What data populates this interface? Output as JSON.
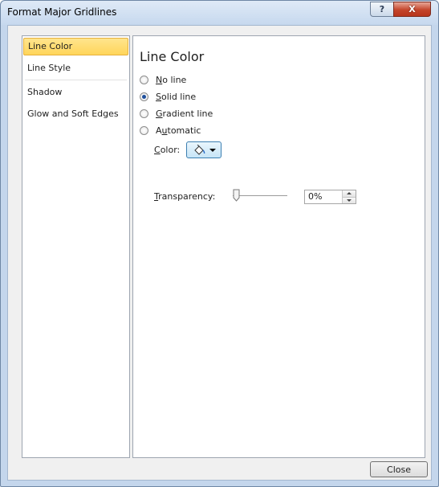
{
  "window": {
    "title": "Format Major Gridlines",
    "help_glyph": "?",
    "close_glyph": "X"
  },
  "nav": {
    "items": [
      {
        "label": "Line Color"
      },
      {
        "label": "Line Style"
      },
      {
        "label": "Shadow"
      },
      {
        "label": "Glow and Soft Edges"
      }
    ],
    "selected": "Line Color"
  },
  "panel": {
    "title": "Line Color",
    "options": [
      {
        "label": "No line",
        "checked": false
      },
      {
        "label": "Solid line",
        "checked": true
      },
      {
        "label": "Gradient line",
        "checked": false
      },
      {
        "label": "Automatic",
        "checked": false
      }
    ],
    "color_label": "Color:",
    "transparency_label": "Transparency:",
    "transparency_value": "0%",
    "transparency_level": 0
  },
  "footer": {
    "close_label": "Close"
  },
  "icons": {
    "color_picker": "paint-bucket-icon",
    "dropdown": "chevron-down-icon"
  },
  "colors": {
    "selected_nav_bg": "#ffd55a",
    "radio_dot": "#1f4f9c",
    "close_button_red": "#c4452b"
  }
}
